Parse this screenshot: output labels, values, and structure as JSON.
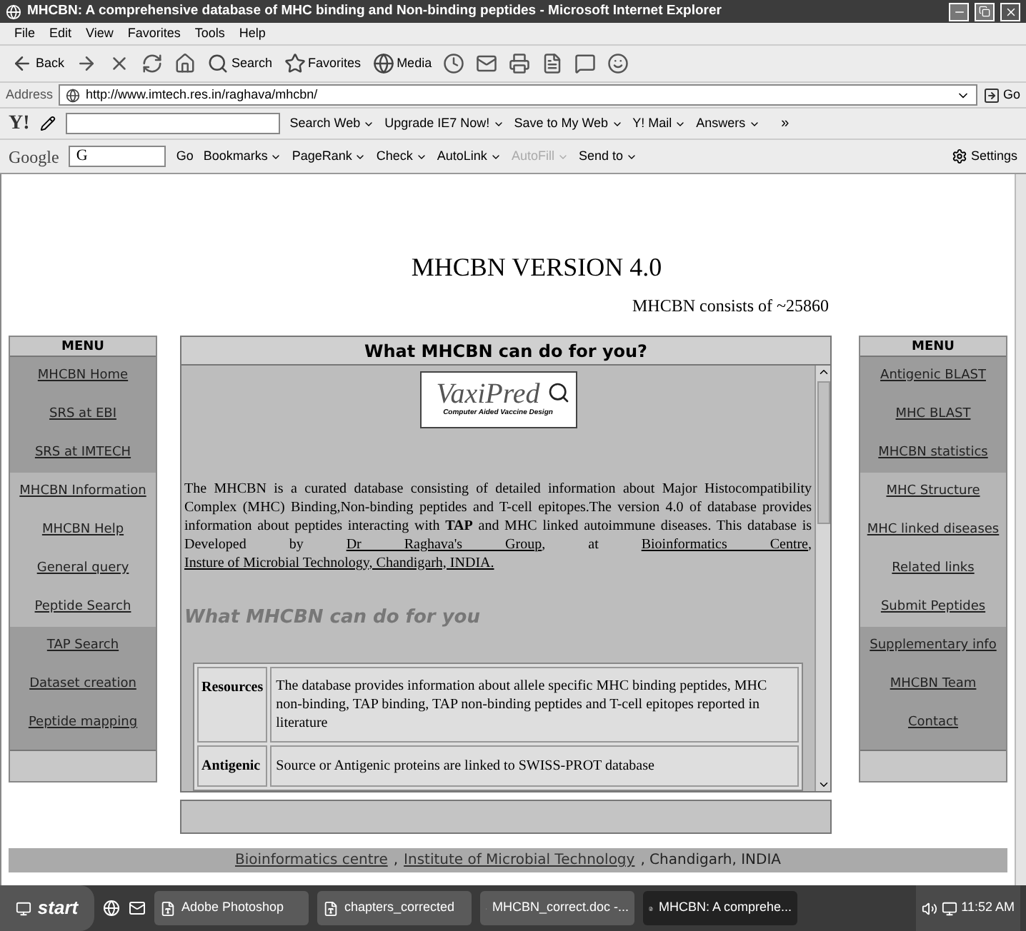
{
  "window": {
    "title": "MHCBN: A comprehensive database of MHC binding and Non-binding peptides - Microsoft Internet Explorer"
  },
  "menu_bar": [
    "File",
    "Edit",
    "View",
    "Favorites",
    "Tools",
    "Help"
  ],
  "toolbar": [
    {
      "kind": "back",
      "label": "Back"
    },
    {
      "kind": "forward"
    },
    {
      "kind": "stop"
    },
    {
      "kind": "refresh"
    },
    {
      "kind": "home"
    },
    {
      "kind": "search",
      "label": "Search"
    },
    {
      "kind": "favorites",
      "label": "Favorites"
    },
    {
      "kind": "media",
      "label": "Media"
    },
    {
      "kind": "history"
    },
    {
      "kind": "mail"
    },
    {
      "kind": "print"
    },
    {
      "kind": "edit"
    },
    {
      "kind": "discuss"
    },
    {
      "kind": "messenger"
    }
  ],
  "address_bar": {
    "label": "Address",
    "url": "http://www.imtech.res.in/raghava/mhcbn/",
    "go": "Go"
  },
  "yahoo_toolbar": {
    "logo": "Y!",
    "buttons": [
      "Search Web",
      "Upgrade IE7 Now!",
      "Save to My Web",
      "Y! Mail",
      "Answers"
    ],
    "more": "»"
  },
  "google_toolbar": {
    "logo": "Google",
    "engine": "G",
    "search_button": "Go",
    "buttons": [
      {
        "label": "Bookmarks",
        "disabled": false
      },
      {
        "label": "PageRank",
        "disabled": false
      },
      {
        "label": "Check",
        "disabled": false
      },
      {
        "label": "AutoLink",
        "disabled": false
      },
      {
        "label": "AutoFill",
        "disabled": true
      },
      {
        "label": "Send to",
        "disabled": false
      }
    ],
    "settings": "Settings"
  },
  "page": {
    "title": "MHCBN VERSION 4.0",
    "subtitle": "MHCBN consists of ~25860",
    "left_menu": {
      "title": "MENU",
      "groups": [
        [
          "MHCBN Home",
          "SRS at EBI",
          "SRS at IMTECH"
        ],
        [
          "MHCBN Information",
          "MHCBN Help",
          "General query",
          "Peptide Search"
        ],
        [
          "TAP Search",
          "Dataset creation",
          "Peptide mapping"
        ]
      ]
    },
    "panel": {
      "title": "What MHCBN can do for you?",
      "logo": {
        "name": "VaxiPred",
        "tagline": "Computer Aided Vaccine Design"
      },
      "paragraph": [
        {
          "kind": "text",
          "text": "The MHCBN is a curated database consisting of detailed information about Major Histocompatibility Complex (MHC) Binding,Non-binding peptides and T-cell epitopes.The version 4.0 of database provides information about peptides interacting with **TAP** and MHC linked autoimmune diseases. This database is Developed by "
        },
        {
          "kind": "link",
          "text": "Dr Raghava's Group"
        },
        {
          "kind": "text",
          "text": ", at "
        },
        {
          "kind": "link",
          "text": "Bioinformatics Centre"
        },
        {
          "kind": "text",
          "text": ", "
        },
        {
          "kind": "link",
          "text": "Insture of Microbial Technology, Chandigarh, INDIA."
        }
      ],
      "heading": "What MHCBN can do for you",
      "table": [
        {
          "label": "Resources",
          "text": "The database provides information about allele specific MHC binding peptides, MHC non-binding, TAP binding, TAP non-binding peptides and T-cell epitopes reported in literature"
        },
        {
          "label": "Antigenic",
          "text": "Source or Antigenic proteins are linked to SWISS-PROT database"
        }
      ]
    },
    "right_menu": {
      "title": "MENU",
      "groups": [
        [
          "Antigenic BLAST",
          "MHC BLAST",
          "MHCBN statistics"
        ],
        [
          "MHC Structure",
          "MHC linked diseases",
          "Related links",
          "Submit Peptides"
        ],
        [
          "Supplementary info",
          "MHCBN Team",
          "Contact"
        ]
      ]
    },
    "footer": [
      {
        "kind": "link",
        "text": "Bioinformatics centre"
      },
      {
        "kind": "text",
        "text": ","
      },
      {
        "kind": "link",
        "text": "Institute of Microbial Technology"
      },
      {
        "kind": "text",
        "text": ", Chandigarh, INDIA"
      }
    ]
  },
  "taskbar": {
    "start": "start",
    "tasks": [
      {
        "label": "Adobe Photoshop",
        "selected": false
      },
      {
        "label": "chapters_corrected",
        "selected": false
      },
      {
        "label": "MHCBN_correct.doc -...",
        "selected": false
      },
      {
        "label": "MHCBN: A comprehe...",
        "selected": true
      }
    ],
    "clock": "11:52 AM"
  }
}
